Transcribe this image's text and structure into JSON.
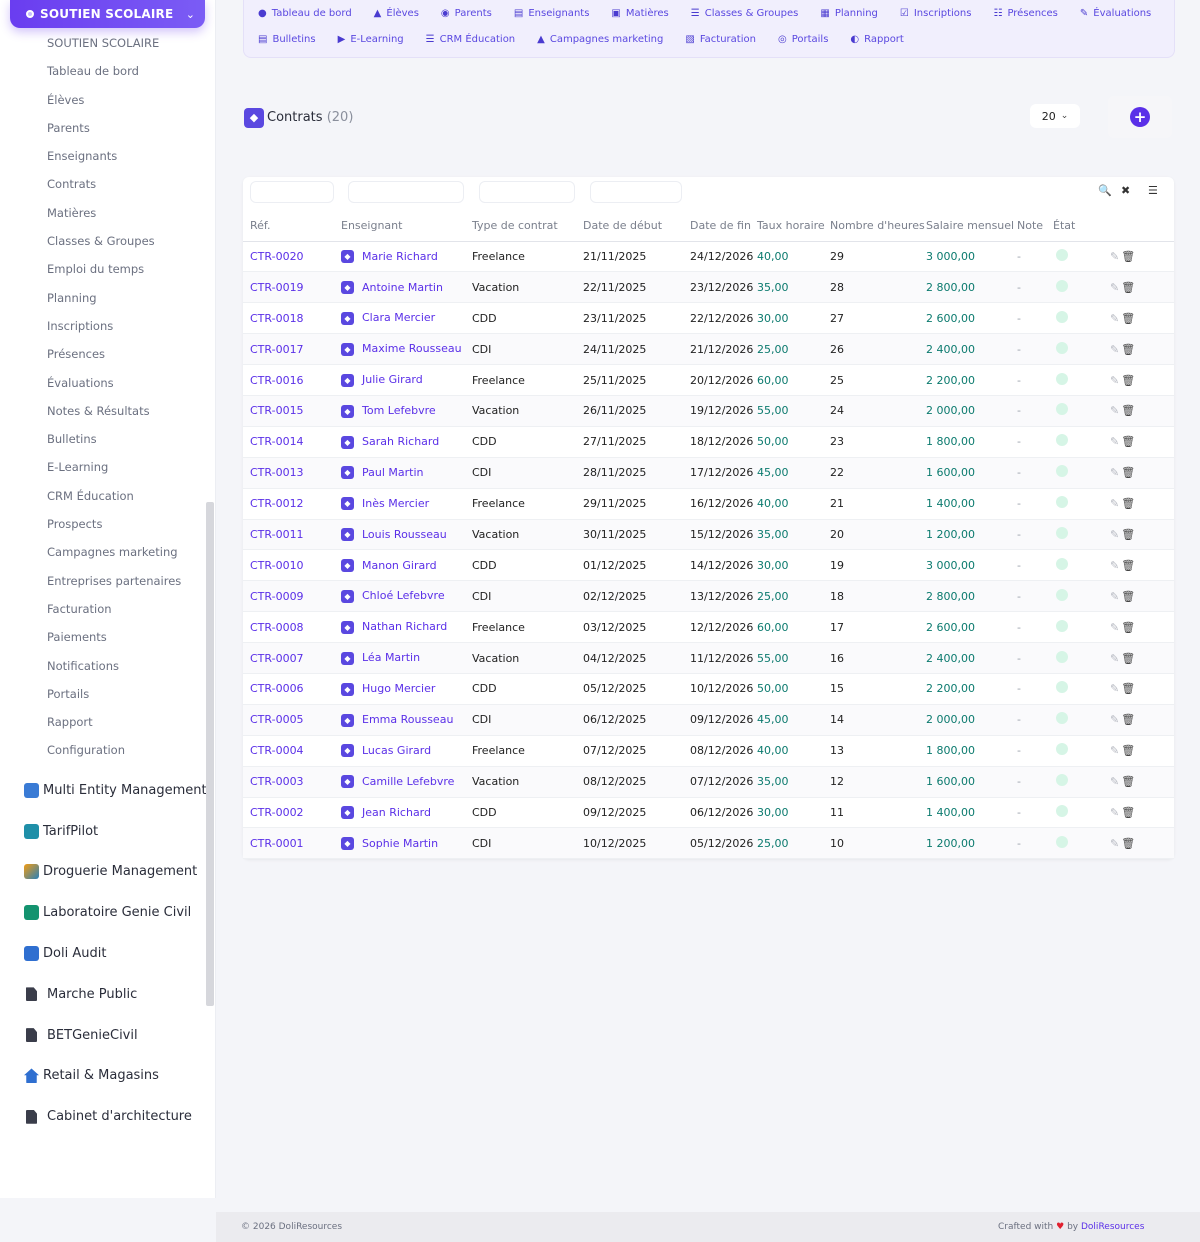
{
  "sidebar": {
    "module_title": "SOUTIEN SCOLAIRE",
    "items": [
      {
        "label": "SOUTIEN SCOLAIRE"
      },
      {
        "label": "Tableau de bord"
      },
      {
        "label": "Élèves"
      },
      {
        "label": "Parents"
      },
      {
        "label": "Enseignants"
      },
      {
        "label": "Contrats"
      },
      {
        "label": "Matières"
      },
      {
        "label": "Classes & Groupes"
      },
      {
        "label": "Emploi du temps"
      },
      {
        "label": "Planning"
      },
      {
        "label": "Inscriptions"
      },
      {
        "label": "Présences"
      },
      {
        "label": "Évaluations"
      },
      {
        "label": "Notes & Résultats"
      },
      {
        "label": "Bulletins"
      },
      {
        "label": "E-Learning"
      },
      {
        "label": "CRM Éducation"
      },
      {
        "label": "Prospects"
      },
      {
        "label": "Campagnes marketing"
      },
      {
        "label": "Entreprises partenaires"
      },
      {
        "label": "Facturation"
      },
      {
        "label": "Paiements"
      },
      {
        "label": "Notifications"
      },
      {
        "label": "Portails"
      },
      {
        "label": "Rapport"
      },
      {
        "label": "Configuration"
      }
    ],
    "modules": [
      {
        "label": "Multi Entity Management",
        "icon": "buildings-icon"
      },
      {
        "label": "TarifPilot",
        "icon": "tarifpilot-icon"
      },
      {
        "label": "Droguerie Management",
        "icon": "droguerie-icon"
      },
      {
        "label": "Laboratoire Genie Civil",
        "icon": "laboratory-icon"
      },
      {
        "label": "Doli Audit",
        "icon": "audit-icon"
      },
      {
        "label": "Marche Public",
        "icon": "document-icon"
      },
      {
        "label": "BETGenieCivil",
        "icon": "document-icon"
      },
      {
        "label": "Retail & Magasins",
        "icon": "house-icon"
      },
      {
        "label": "Cabinet d'architecture",
        "icon": "document-icon"
      }
    ]
  },
  "topnav": {
    "row1": [
      "Tableau de bord",
      "Élèves",
      "Parents",
      "Enseignants",
      "Matières",
      "Classes & Groupes",
      "Planning",
      "Inscriptions",
      "Présences",
      "Évaluations"
    ],
    "row2": [
      "Bulletins",
      "E-Learning",
      "CRM Éducation",
      "Campagnes marketing",
      "Facturation",
      "Portails",
      "Rapport"
    ]
  },
  "page": {
    "title": "Contrats",
    "count": "(20)",
    "per_page": "20"
  },
  "table": {
    "headers": [
      "Réf.",
      "Enseignant",
      "Type de contrat",
      "Date de début",
      "Date de fin",
      "Taux horaire",
      "Nombre d'heures",
      "Salaire mensuel",
      "Note",
      "État"
    ],
    "rows": [
      [
        "CTR-0020",
        "Marie Richard",
        "Freelance",
        "21/11/2025",
        "24/12/2026",
        "40,00",
        "29",
        "3 000,00",
        "-"
      ],
      [
        "CTR-0019",
        "Antoine Martin",
        "Vacation",
        "22/11/2025",
        "23/12/2026",
        "35,00",
        "28",
        "2 800,00",
        "-"
      ],
      [
        "CTR-0018",
        "Clara Mercier",
        "CDD",
        "23/11/2025",
        "22/12/2026",
        "30,00",
        "27",
        "2 600,00",
        "-"
      ],
      [
        "CTR-0017",
        "Maxime Rousseau",
        "CDI",
        "24/11/2025",
        "21/12/2026",
        "25,00",
        "26",
        "2 400,00",
        "-"
      ],
      [
        "CTR-0016",
        "Julie Girard",
        "Freelance",
        "25/11/2025",
        "20/12/2026",
        "60,00",
        "25",
        "2 200,00",
        "-"
      ],
      [
        "CTR-0015",
        "Tom Lefebvre",
        "Vacation",
        "26/11/2025",
        "19/12/2026",
        "55,00",
        "24",
        "2 000,00",
        "-"
      ],
      [
        "CTR-0014",
        "Sarah Richard",
        "CDD",
        "27/11/2025",
        "18/12/2026",
        "50,00",
        "23",
        "1 800,00",
        "-"
      ],
      [
        "CTR-0013",
        "Paul Martin",
        "CDI",
        "28/11/2025",
        "17/12/2026",
        "45,00",
        "22",
        "1 600,00",
        "-"
      ],
      [
        "CTR-0012",
        "Inès Mercier",
        "Freelance",
        "29/11/2025",
        "16/12/2026",
        "40,00",
        "21",
        "1 400,00",
        "-"
      ],
      [
        "CTR-0011",
        "Louis Rousseau",
        "Vacation",
        "30/11/2025",
        "15/12/2026",
        "35,00",
        "20",
        "1 200,00",
        "-"
      ],
      [
        "CTR-0010",
        "Manon Girard",
        "CDD",
        "01/12/2025",
        "14/12/2026",
        "30,00",
        "19",
        "3 000,00",
        "-"
      ],
      [
        "CTR-0009",
        "Chloé Lefebvre",
        "CDI",
        "02/12/2025",
        "13/12/2026",
        "25,00",
        "18",
        "2 800,00",
        "-"
      ],
      [
        "CTR-0008",
        "Nathan Richard",
        "Freelance",
        "03/12/2025",
        "12/12/2026",
        "60,00",
        "17",
        "2 600,00",
        "-"
      ],
      [
        "CTR-0007",
        "Léa Martin",
        "Vacation",
        "04/12/2025",
        "11/12/2026",
        "55,00",
        "16",
        "2 400,00",
        "-"
      ],
      [
        "CTR-0006",
        "Hugo Mercier",
        "CDD",
        "05/12/2025",
        "10/12/2026",
        "50,00",
        "15",
        "2 200,00",
        "-"
      ],
      [
        "CTR-0005",
        "Emma Rousseau",
        "CDI",
        "06/12/2025",
        "09/12/2026",
        "45,00",
        "14",
        "2 000,00",
        "-"
      ],
      [
        "CTR-0004",
        "Lucas Girard",
        "Freelance",
        "07/12/2025",
        "08/12/2026",
        "40,00",
        "13",
        "1 800,00",
        "-"
      ],
      [
        "CTR-0003",
        "Camille Lefebvre",
        "Vacation",
        "08/12/2025",
        "07/12/2026",
        "35,00",
        "12",
        "1 600,00",
        "-"
      ],
      [
        "CTR-0002",
        "Jean Richard",
        "CDD",
        "09/12/2025",
        "06/12/2026",
        "30,00",
        "11",
        "1 400,00",
        "-"
      ],
      [
        "CTR-0001",
        "Sophie Martin",
        "CDI",
        "10/12/2025",
        "05/12/2026",
        "25,00",
        "10",
        "1 200,00",
        "-"
      ]
    ]
  },
  "footer": {
    "copyright": "© 2026 DoliResources",
    "crafted": "Crafted with",
    "by": "by",
    "brand": "DoliResources"
  },
  "colors": {
    "accent": "#5a2fe8",
    "money": "#0b7a6e",
    "state_active": "#d6f5e6"
  }
}
